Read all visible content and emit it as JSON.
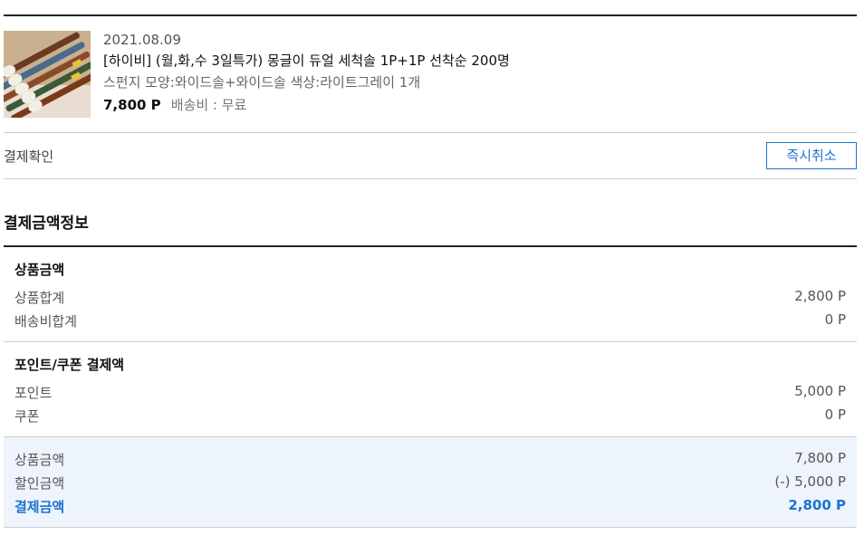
{
  "order": {
    "date": "2021.08.09",
    "title": "[하이비] (월,화,수 3일특가) 몽글이 듀얼 세척솔 1P+1P 선착순 200명",
    "option": "스펀지 모양:와이드솔+와이드솔 색상:라이트그레이 1개",
    "price": "7,800 P",
    "shipping": "배송비 : 무료"
  },
  "status": {
    "label": "결제확인",
    "cancel_button": "즉시취소"
  },
  "payment": {
    "section_title": "결제금액정보",
    "product": {
      "heading": "상품금액",
      "rows": [
        {
          "label": "상품합계",
          "value": "2,800 P"
        },
        {
          "label": "배송비합계",
          "value": "0 P"
        }
      ]
    },
    "discount": {
      "heading": "포인트/쿠폰 결제액",
      "rows": [
        {
          "label": "포인트",
          "value": "5,000 P"
        },
        {
          "label": "쿠폰",
          "value": "0 P"
        }
      ]
    },
    "summary": {
      "rows": [
        {
          "label": "상품금액",
          "value": "7,800 P"
        },
        {
          "label": "할인금액",
          "value": "(-) 5,000 P"
        },
        {
          "label": "결제금액",
          "value": "2,800 P"
        }
      ]
    }
  },
  "colors": {
    "accent": "#1a73d1",
    "summary_bg": "#eef4fc"
  }
}
